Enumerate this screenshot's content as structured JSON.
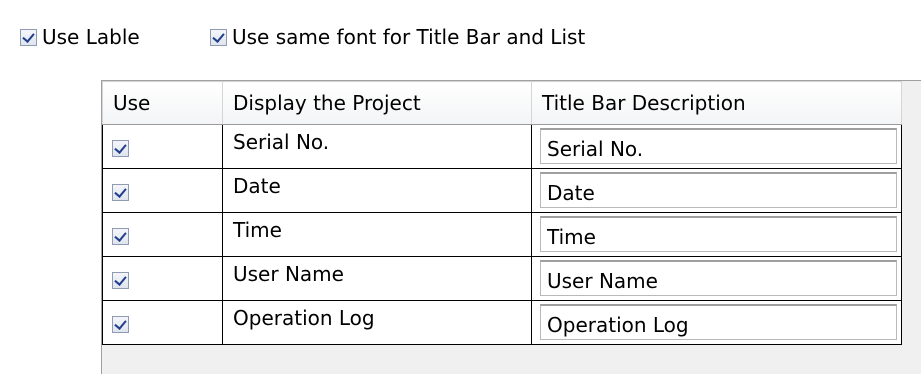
{
  "options": {
    "use_label": {
      "label": "Use Lable",
      "checked": true
    },
    "same_font": {
      "label": "Use same font for Title Bar and List",
      "checked": true
    }
  },
  "table": {
    "headers": [
      "Use",
      "Display the Project",
      "Title Bar Description"
    ],
    "rows": [
      {
        "use": true,
        "project": "Serial No.",
        "description": "Serial No."
      },
      {
        "use": true,
        "project": "Date",
        "description": "Date"
      },
      {
        "use": true,
        "project": "Time",
        "description": "Time"
      },
      {
        "use": true,
        "project": "User Name",
        "description": "User Name"
      },
      {
        "use": true,
        "project": "Operation Log",
        "description": "Operation Log"
      }
    ]
  },
  "colors": {
    "checkmark": "#1f3f8a",
    "checkbox_border": "#8f9bb3",
    "grid_background": "#f0f0f0"
  }
}
